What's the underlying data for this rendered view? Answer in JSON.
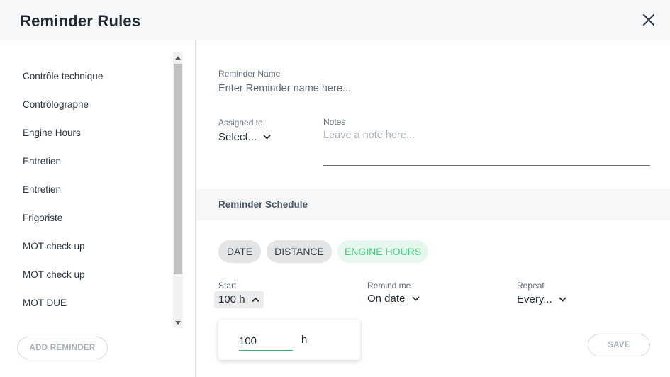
{
  "header": {
    "title": "Reminder Rules",
    "close_icon": "close-icon"
  },
  "sidebar": {
    "items": [
      {
        "label": "Contrôle technique"
      },
      {
        "label": "Contrôlographe"
      },
      {
        "label": "Engine Hours"
      },
      {
        "label": "Entretien"
      },
      {
        "label": "Entretien"
      },
      {
        "label": "Frigoriste"
      },
      {
        "label": "MOT check up"
      },
      {
        "label": "MOT check up"
      },
      {
        "label": "MOT DUE"
      }
    ],
    "add_button": "ADD REMINDER"
  },
  "form": {
    "name_label": "Reminder Name",
    "name_placeholder": "Enter Reminder name here...",
    "assigned_label": "Assigned to",
    "assigned_value": "Select...",
    "notes_label": "Notes",
    "notes_placeholder": "Leave a note here..."
  },
  "schedule": {
    "title": "Reminder Schedule",
    "chips": {
      "date": "DATE",
      "distance": "DISTANCE",
      "engine_hours": "ENGINE HOURS"
    },
    "active_chip": "ENGINE HOURS",
    "start_label": "Start",
    "start_value": "100 h",
    "remind_label": "Remind me",
    "remind_value": "On date",
    "repeat_label": "Repeat",
    "repeat_value": "Every...",
    "popover_value": "100",
    "popover_unit": "h",
    "save_button": "SAVE"
  },
  "colors": {
    "accent_green": "#3ecf7e",
    "input_underline": "#2dbd6e"
  }
}
